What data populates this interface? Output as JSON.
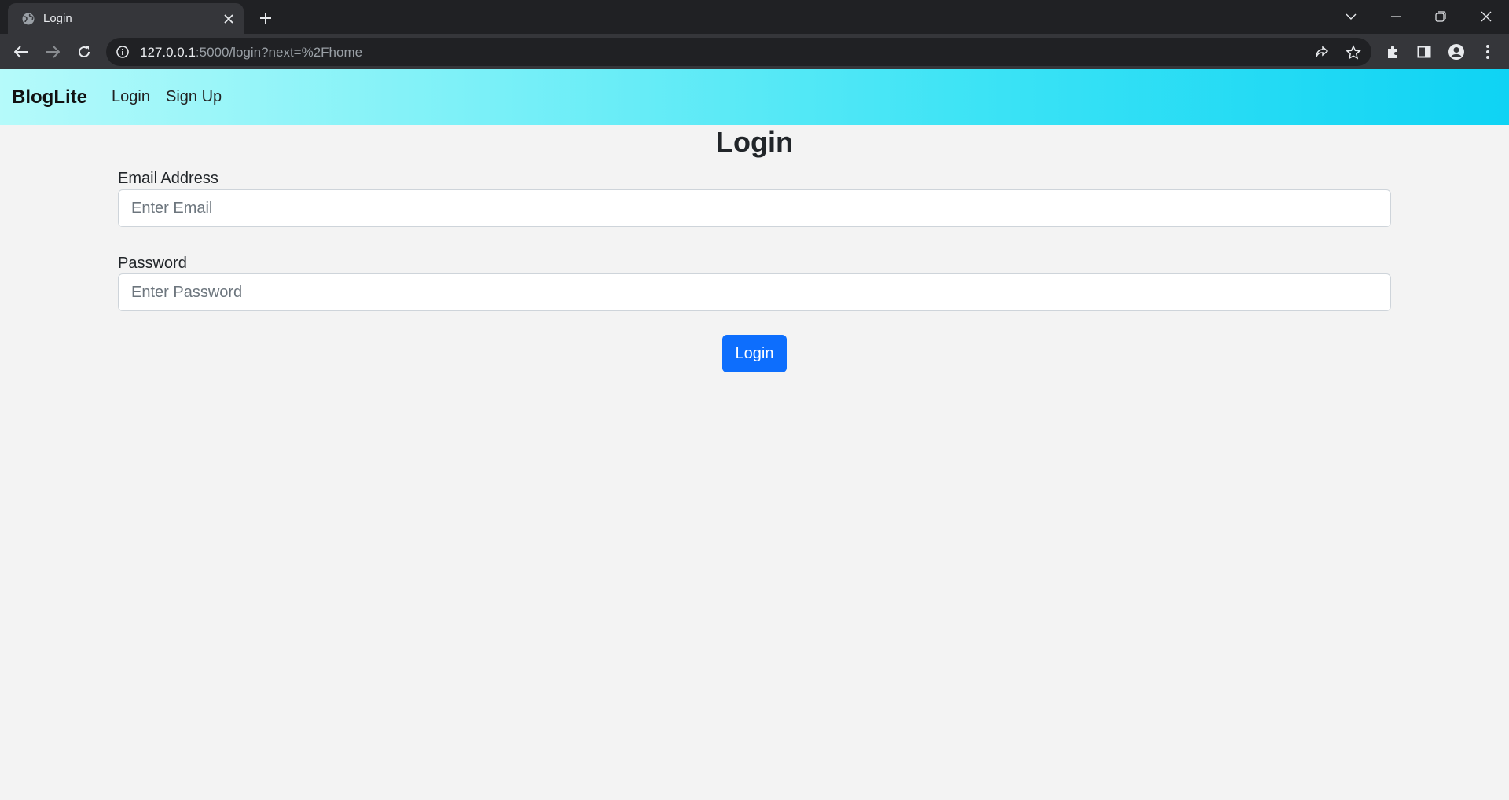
{
  "browser": {
    "tab": {
      "title": "Login",
      "favicon": "globe-icon"
    },
    "url": {
      "host": "127.0.0.1",
      "rest": ":5000/login?next=%2Fhome"
    }
  },
  "navbar": {
    "brand": "BlogLite",
    "links": [
      "Login",
      "Sign Up"
    ],
    "gradient": [
      "#b5fafa",
      "#0fd3f4"
    ]
  },
  "form": {
    "title": "Login",
    "email": {
      "label": "Email Address",
      "placeholder": "Enter Email",
      "value": ""
    },
    "password": {
      "label": "Password",
      "placeholder": "Enter Password",
      "value": ""
    },
    "submit_label": "Login",
    "submit_color": "#0d6efd"
  }
}
